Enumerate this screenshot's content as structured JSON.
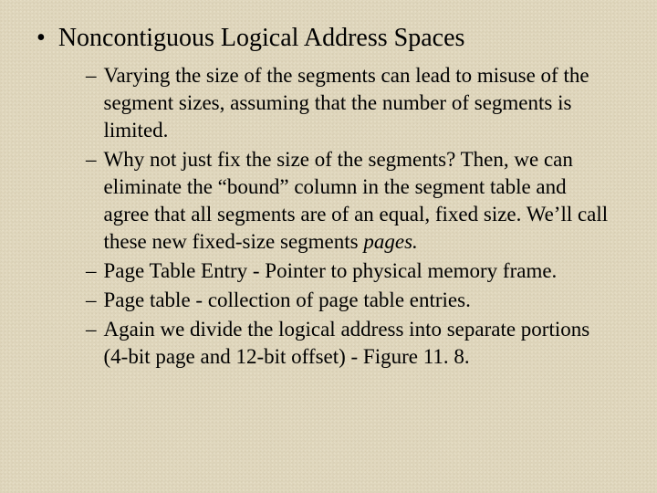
{
  "slide": {
    "title": "Noncontiguous Logical Address Spaces",
    "bullets": [
      "Varying the size of the segments can lead to misuse of the segment sizes, assuming that the number of segments is limited.",
      "Why not just fix the size of the segments?  Then, we can eliminate the “bound” column in the segment table and agree that all segments are of an equal, fixed size.  We’ll call these new fixed-size segments ",
      "Page Table Entry - Pointer to physical memory frame.",
      "Page table - collection of page table entries.",
      "Again we divide the logical address into separate portions (4-bit page and 12-bit offset) - Figure 11. 8."
    ],
    "emph_pages": "pages."
  }
}
